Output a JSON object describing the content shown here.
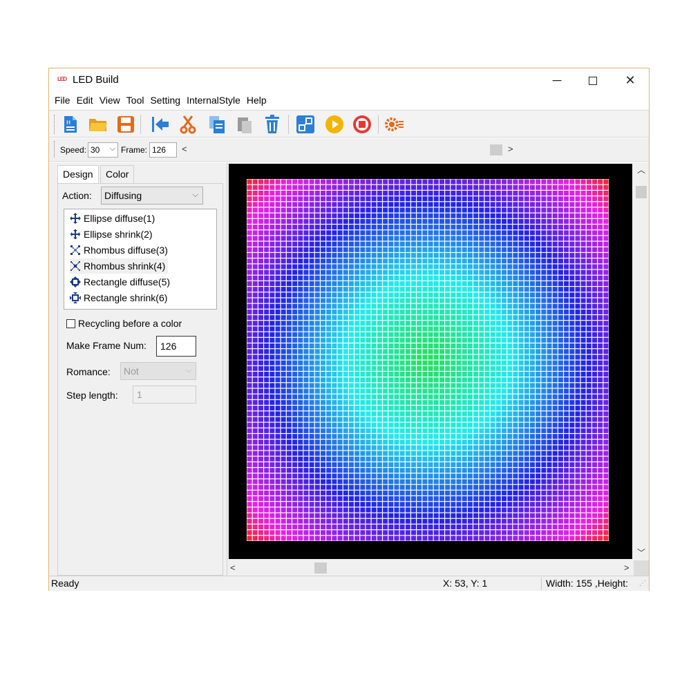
{
  "window": {
    "title": "LED Build",
    "icon": "led-app-icon",
    "minimize": "─",
    "close": "✕"
  },
  "menu": [
    "File",
    "Edit",
    "View",
    "Tool",
    "Setting",
    "InternalStyle",
    "Help"
  ],
  "toolbar": {
    "icons": [
      "new-file-icon",
      "open-folder-icon",
      "save-icon",
      "import-icon",
      "cut-icon",
      "copy-icon",
      "paste-icon",
      "delete-icon",
      "layout-icon",
      "play-icon",
      "stop-icon",
      "settings-icon"
    ]
  },
  "speedbar": {
    "speed_label": "Speed:",
    "speed_value": "30",
    "frame_label": "Frame:",
    "frame_value": "126",
    "left_arrow": "<",
    "right_arrow": ">"
  },
  "left_panel": {
    "tabs": [
      "Design",
      "Color"
    ],
    "action_label": "Action:",
    "action_value": "Diffusing",
    "actions": [
      "Ellipse diffuse(1)",
      "Ellipse shrink(2)",
      "Rhombus diffuse(3)",
      "Rhombus shrink(4)",
      "Rectangle diffuse(5)",
      "Rectangle shrink(6)"
    ],
    "selected_action_index": 3,
    "recycling_label": "Recycling before a color",
    "recycling_checked": false,
    "make_frame_label": "Make Frame Num:",
    "make_frame_value": "126",
    "romance_label": "Romance:",
    "romance_value": "Not",
    "step_label": "Step length:",
    "step_value": "1"
  },
  "canvas": {
    "grid_cols": 64,
    "grid_rows": 64,
    "center_color": "#22e05a",
    "ring_colors": [
      "#22e05a",
      "#22ecec",
      "#2222e8",
      "#e822e8",
      "#ff2222"
    ],
    "grid_line_color": "#ffffff",
    "background": "#000000"
  },
  "status": {
    "text": "Ready",
    "coords": "X: 53, Y: 1",
    "size": "Width: 155 ,Height:"
  }
}
